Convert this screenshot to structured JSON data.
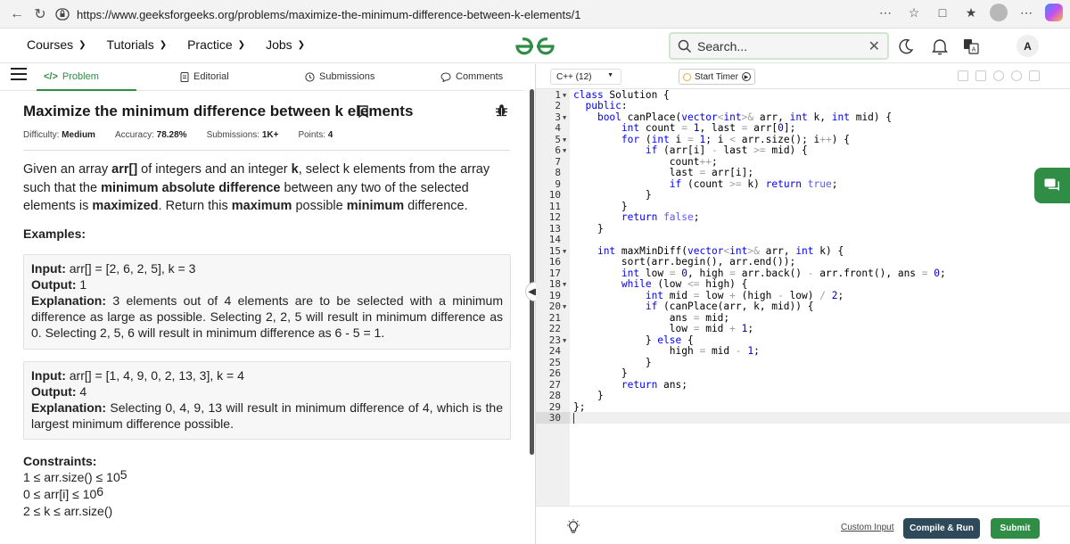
{
  "browser": {
    "url": "https://www.geeksforgeeks.org/problems/maximize-the-minimum-difference-between-k-elements/1"
  },
  "header": {
    "nav": [
      {
        "label": "Courses"
      },
      {
        "label": "Tutorials"
      },
      {
        "label": "Practice"
      },
      {
        "label": "Jobs"
      }
    ],
    "search_placeholder": "Search...",
    "avatar_letter": "A",
    "brand_color": "#2f8d46"
  },
  "tabs": [
    {
      "label": "Problem"
    },
    {
      "label": "Editorial"
    },
    {
      "label": "Submissions"
    },
    {
      "label": "Comments"
    }
  ],
  "problem": {
    "title": "Maximize the minimum difference between k elements",
    "difficulty_label": "Difficulty:",
    "difficulty": "Medium",
    "accuracy_label": "Accuracy:",
    "accuracy": "78.28%",
    "submissions_label": "Submissions:",
    "submissions": "1K+",
    "points_label": "Points:",
    "points": "4",
    "desc": {
      "p1": "Given an array ",
      "b1": "arr[]",
      "p2": " of integers and an integer ",
      "b2": "k",
      "p3": ", select k elements from the array such that the ",
      "b3": "minimum absolute difference",
      "p4": " between any two of the selected elements is ",
      "b4": "maximized",
      "p5": ". Return this ",
      "b5": "maximum",
      "p6": " possible ",
      "b6": "minimum",
      "p7": " difference."
    },
    "examples_heading": "Examples:",
    "input_label": "Input:",
    "output_label": "Output:",
    "explanation_label": "Explanation:",
    "examples": [
      {
        "input": "arr[] = [2, 6, 2, 5], k = 3",
        "output": "1",
        "explanation": "3 elements out of 4 elements are to be selected with a minimum difference as large as possible. Selecting 2, 2, 5 will result in minimum difference as 0. Selecting 2, 5, 6 will result in minimum difference as 6 - 5 = 1."
      },
      {
        "input": "arr[] = [1, 4, 9, 0, 2, 13, 3], k = 4",
        "output": "4",
        "explanation": "Selecting 0, 4, 9, 13 will result in minimum difference of 4, which is the largest minimum difference possible."
      }
    ],
    "constraints_heading": "Constraints:",
    "constraints": [
      {
        "text": "1 ≤ arr.size() ≤ 10",
        "sup": "5"
      },
      {
        "text": "0 ≤ arr[i] ≤ 10",
        "sup": "6"
      },
      {
        "text": "2 ≤ k ≤ arr.size()",
        "sup": ""
      }
    ]
  },
  "editor": {
    "language": "C++ (12)",
    "timer_label": "Start Timer",
    "custom_input_label": "Custom Input",
    "compile_label": "Compile & Run",
    "submit_label": "Submit",
    "code_lines": [
      "class Solution {",
      "  public:",
      "    bool canPlace(vector<int>& arr, int k, int mid) {",
      "        int count = 1, last = arr[0];",
      "        for (int i = 1; i < arr.size(); i++) {",
      "            if (arr[i] - last >= mid) {",
      "                count++;",
      "                last = arr[i];",
      "                if (count >= k) return true;",
      "            }",
      "        }",
      "        return false;",
      "    }",
      "",
      "    int maxMinDiff(vector<int>& arr, int k) {",
      "        sort(arr.begin(), arr.end());",
      "        int low = 0, high = arr.back() - arr.front(), ans = 0;",
      "        while (low <= high) {",
      "            int mid = low + (high - low) / 2;",
      "            if (canPlace(arr, k, mid)) {",
      "                ans = mid;",
      "                low = mid + 1;",
      "            } else {",
      "                high = mid - 1;",
      "            }",
      "        }",
      "        return ans;",
      "    }",
      "};",
      ""
    ],
    "fold_lines": [
      1,
      3,
      5,
      6,
      15,
      18,
      20,
      23
    ]
  }
}
